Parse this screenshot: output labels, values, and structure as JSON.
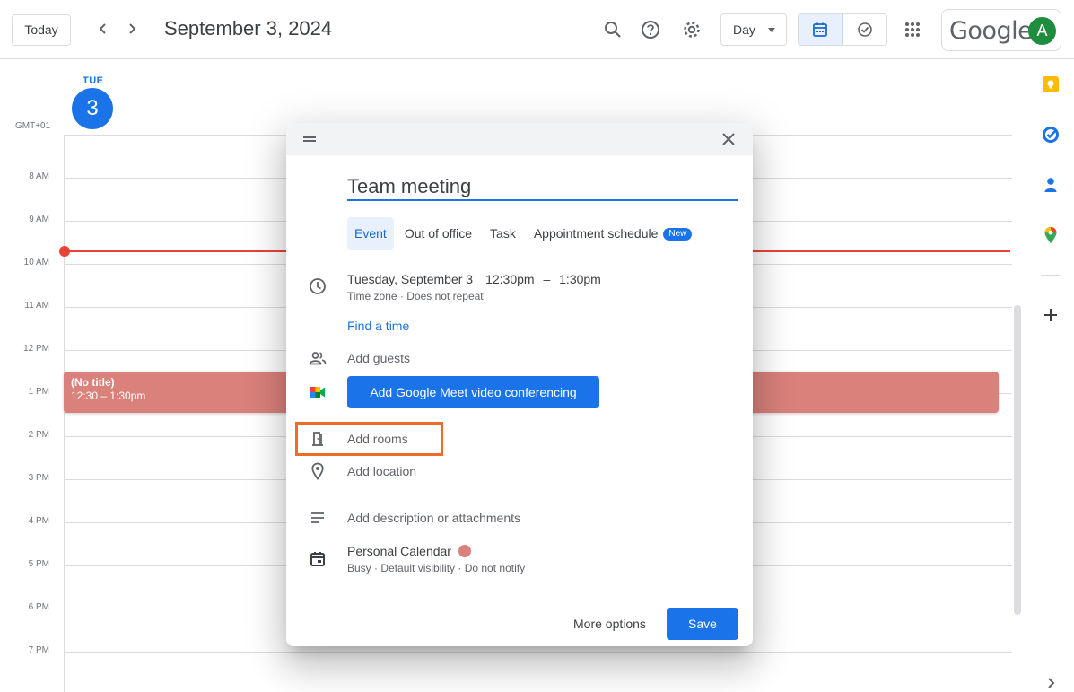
{
  "header": {
    "today_label": "Today",
    "date_title": "September 3, 2024",
    "view_label": "Day",
    "brand": "Google",
    "avatar_initial": "A"
  },
  "day_header": {
    "dow": "TUE",
    "day_number": "3",
    "timezone": "GMT+01"
  },
  "grid": {
    "hours": [
      "8 AM",
      "9 AM",
      "10 AM",
      "11 AM",
      "12 PM",
      "1 PM",
      "2 PM",
      "3 PM",
      "4 PM",
      "5 PM",
      "6 PM",
      "7 PM"
    ],
    "event": {
      "title": "(No title)",
      "time": "12:30 – 1:30pm"
    }
  },
  "dialog": {
    "title_value": "Team meeting",
    "tabs": [
      "Event",
      "Out of office",
      "Task",
      "Appointment schedule"
    ],
    "new_badge": "New",
    "date": "Tuesday, September 3",
    "time_start": "12:30pm",
    "time_dash": "–",
    "time_end": "1:30pm",
    "time_sub": "Time zone · Does not repeat",
    "find_time": "Find a time",
    "add_guests": "Add guests",
    "meet_button": "Add Google Meet video conferencing",
    "add_rooms": "Add rooms",
    "add_location": "Add location",
    "add_description": "Add description or attachments",
    "calendar_name": "Personal Calendar",
    "calendar_sub": "Busy · Default visibility · Do not notify",
    "more_options": "More options",
    "save": "Save"
  },
  "colors": {
    "accent": "#1a73e8",
    "now_line": "#ea4335",
    "event": "#d9817a",
    "highlight": "#ee6c25"
  }
}
